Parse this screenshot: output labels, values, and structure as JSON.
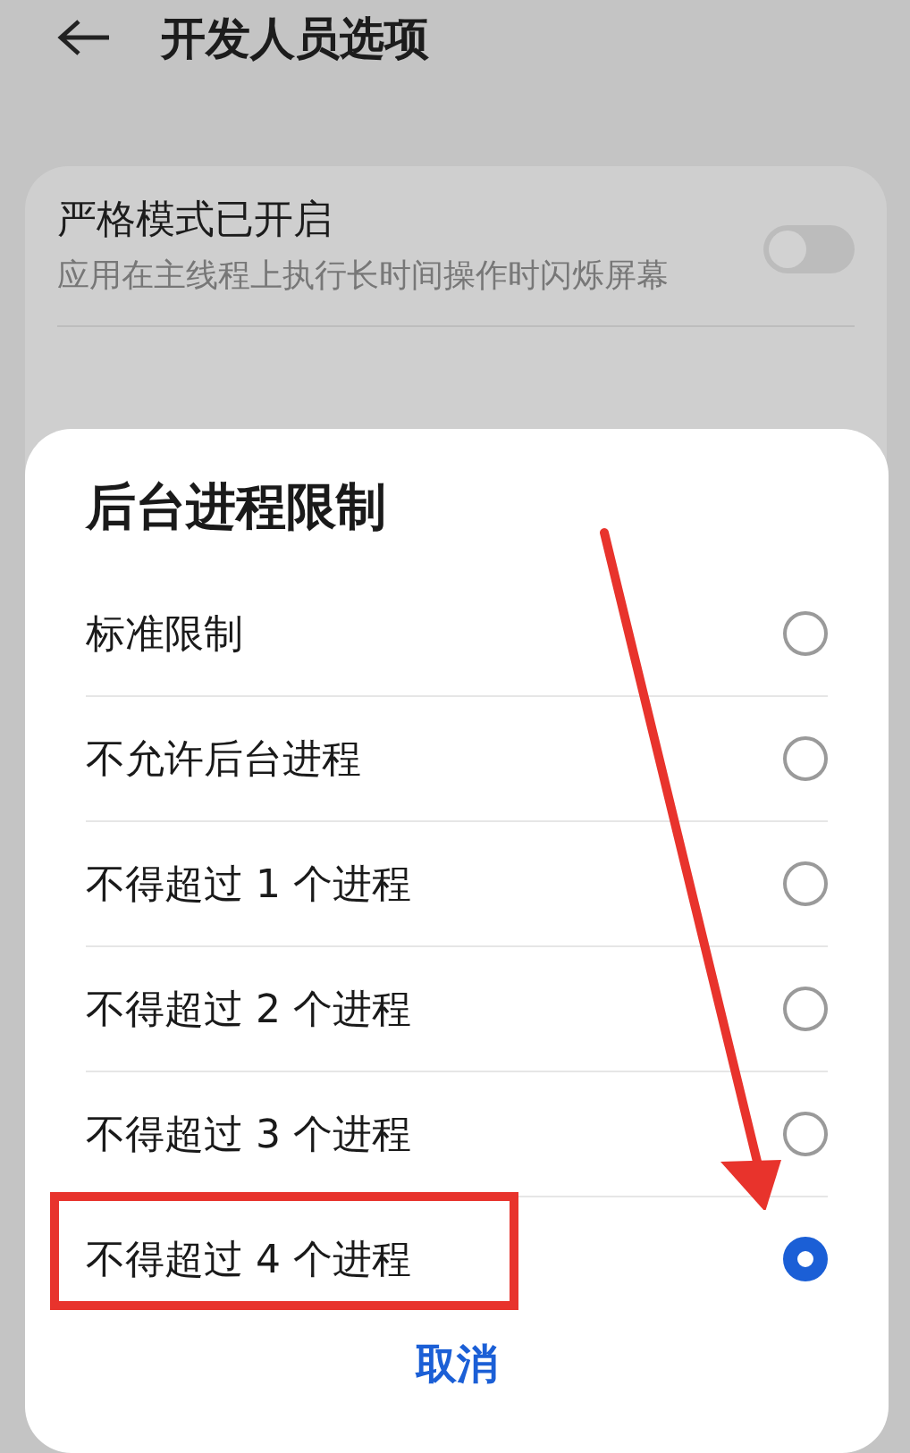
{
  "header": {
    "title": "开发人员选项"
  },
  "settings": [
    {
      "kind": "switch",
      "title": "严格模式已开启",
      "subtitle": "应用在主线程上执行长时间操作时闪烁屏幕",
      "on": false
    }
  ],
  "dialog": {
    "title": "后台进程限制",
    "options": [
      {
        "label": "标准限制",
        "selected": false
      },
      {
        "label": "不允许后台进程",
        "selected": false
      },
      {
        "label": "不得超过 1 个进程",
        "selected": false
      },
      {
        "label": "不得超过 2 个进程",
        "selected": false
      },
      {
        "label": "不得超过 3 个进程",
        "selected": false
      },
      {
        "label": "不得超过 4 个进程",
        "selected": true
      }
    ],
    "cancel": "取消"
  }
}
